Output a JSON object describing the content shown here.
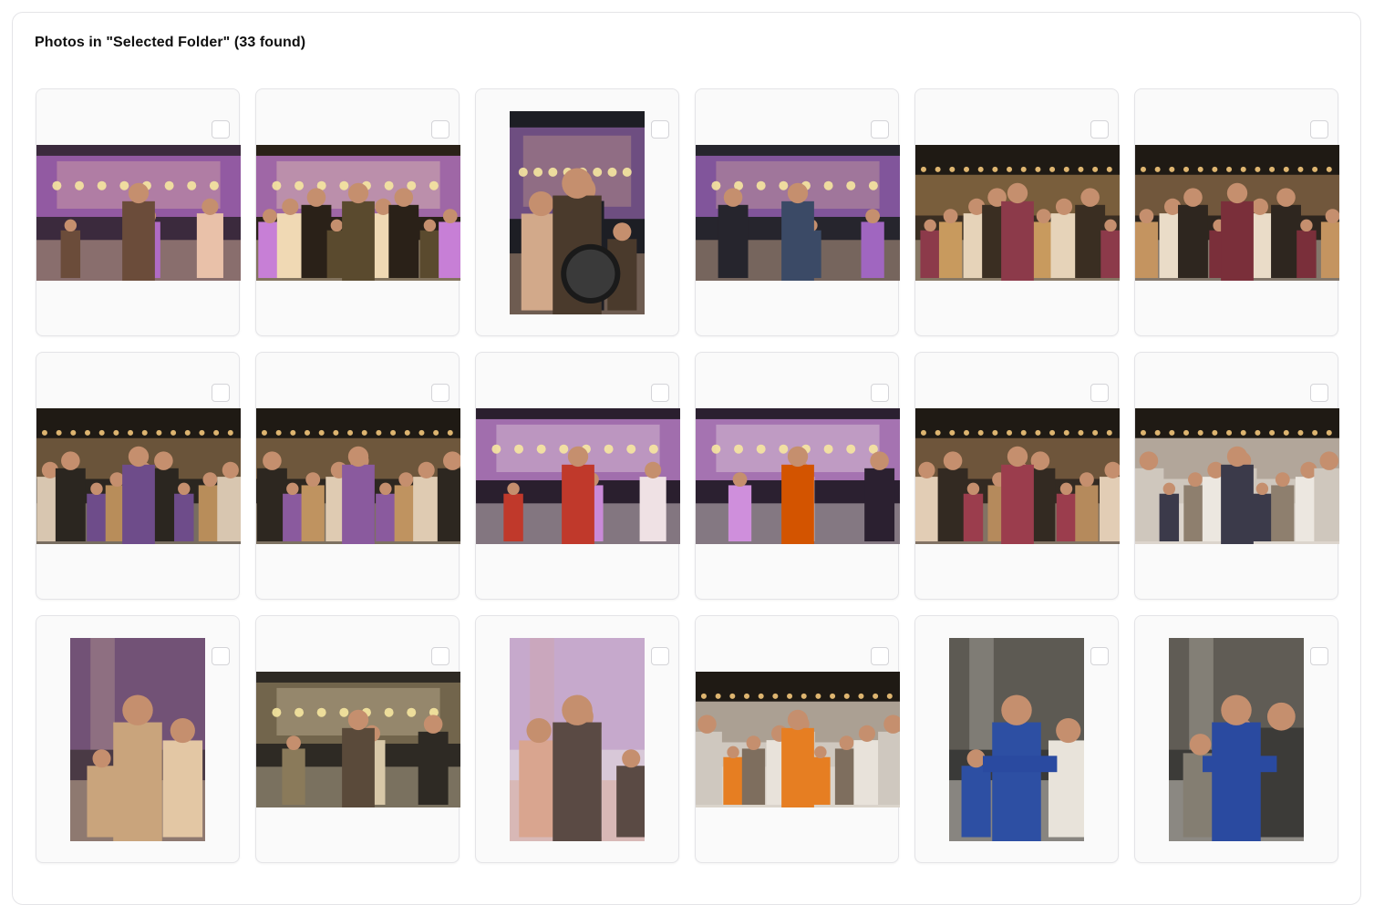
{
  "gallery": {
    "title": "Photos in \"Selected Folder\" (33 found)"
  },
  "colors": {
    "card_bg": "#fafafa",
    "card_border": "#e4e4e7",
    "checkbox_border": "#d4d4d8"
  },
  "photos": [
    {
      "orientation": "landscape",
      "scene": "band-on-stage",
      "selected": false,
      "palette": [
        "#3b2a3d",
        "#b06bc4",
        "#e9c1a9",
        "#6b4c3a"
      ]
    },
    {
      "orientation": "landscape",
      "scene": "stage-with-audience",
      "selected": false,
      "palette": [
        "#2a2118",
        "#c77fd6",
        "#f0d9b4",
        "#5a4a2e"
      ]
    },
    {
      "orientation": "portrait",
      "scene": "drummer-on-stage",
      "selected": false,
      "palette": [
        "#1d1e24",
        "#8a5fa0",
        "#d2a98a",
        "#4a3a2c"
      ]
    },
    {
      "orientation": "landscape",
      "scene": "band-on-stage",
      "selected": false,
      "palette": [
        "#26252d",
        "#a066c0",
        "#d9b49a",
        "#3b4a66"
      ]
    },
    {
      "orientation": "landscape",
      "scene": "dance-floor-crowd",
      "selected": false,
      "palette": [
        "#3a2e22",
        "#c89a5e",
        "#e6d3b9",
        "#8c3a4a"
      ]
    },
    {
      "orientation": "landscape",
      "scene": "dance-floor-crowd",
      "selected": false,
      "palette": [
        "#2e261f",
        "#c49460",
        "#eadcc8",
        "#7a2f3a"
      ]
    },
    {
      "orientation": "landscape",
      "scene": "dance-floor-crowd",
      "selected": false,
      "palette": [
        "#2b2620",
        "#b88d5a",
        "#d8c6b0",
        "#6e4c8a"
      ]
    },
    {
      "orientation": "landscape",
      "scene": "dance-floor-crowd",
      "selected": false,
      "palette": [
        "#2d2720",
        "#bf9360",
        "#dfcbb2",
        "#8a5a9e"
      ]
    },
    {
      "orientation": "landscape",
      "scene": "couple-dancing-stage",
      "selected": false,
      "palette": [
        "#2a1f2e",
        "#c98ad8",
        "#efe1e4",
        "#c0392b"
      ]
    },
    {
      "orientation": "landscape",
      "scene": "couple-dancing-stage",
      "selected": false,
      "palette": [
        "#2b2030",
        "#cf8fdc",
        "#f1e4e6",
        "#d35400"
      ]
    },
    {
      "orientation": "landscape",
      "scene": "dance-floor-crowd",
      "selected": false,
      "palette": [
        "#332a22",
        "#b58a5c",
        "#e2cdb5",
        "#9b3d4d"
      ]
    },
    {
      "orientation": "landscape",
      "scene": "singer-in-crowd",
      "selected": false,
      "palette": [
        "#cfc7bd",
        "#8e7f6e",
        "#ece7e0",
        "#3b3a4a"
      ]
    },
    {
      "orientation": "portrait",
      "scene": "singer-with-mic",
      "selected": false,
      "palette": [
        "#4a3a45",
        "#9a6aa8",
        "#e3c7a4",
        "#c9a47c"
      ]
    },
    {
      "orientation": "landscape",
      "scene": "singer-by-stage",
      "selected": false,
      "palette": [
        "#2e2a24",
        "#8a7a5a",
        "#d8c8a8",
        "#5a4a3a"
      ]
    },
    {
      "orientation": "portrait",
      "scene": "speaker-with-mic",
      "selected": false,
      "palette": [
        "#d8c8d8",
        "#b48ac0",
        "#d9a58f",
        "#5a4a44"
      ]
    },
    {
      "orientation": "landscape",
      "scene": "singers-in-crowd",
      "selected": false,
      "palette": [
        "#cfc8bf",
        "#7e6e5e",
        "#e8e2da",
        "#e67e22"
      ]
    },
    {
      "orientation": "portrait",
      "scene": "guitarist-seated",
      "selected": false,
      "palette": [
        "#3a3a38",
        "#7f7a6e",
        "#e8e3da",
        "#2d4fa3"
      ]
    },
    {
      "orientation": "portrait",
      "scene": "guitarist-seated",
      "selected": false,
      "palette": [
        "#3c3b38",
        "#847e72",
        "#ebe6dd",
        "#2a4aa0"
      ]
    }
  ]
}
